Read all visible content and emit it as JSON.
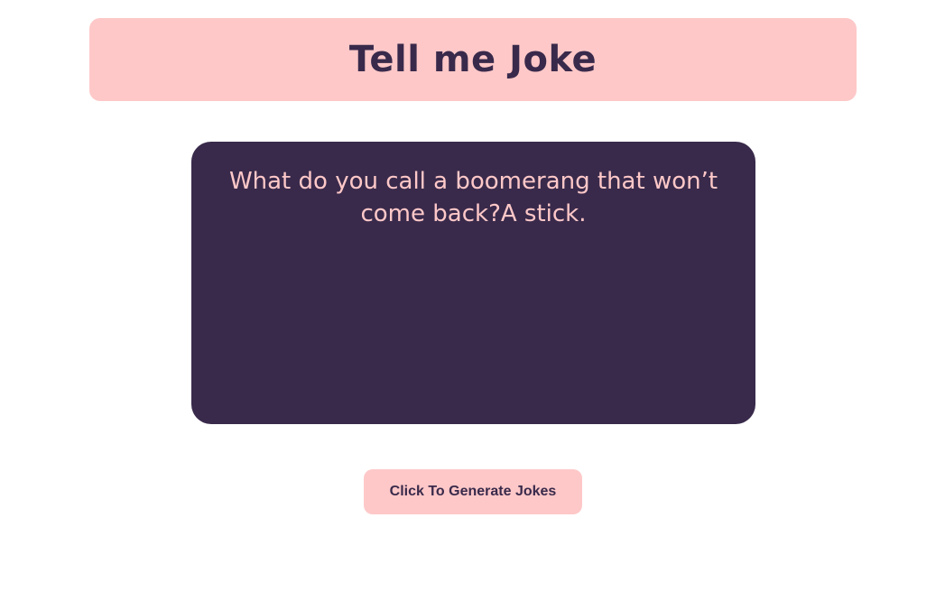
{
  "header": {
    "title": "Tell me Joke"
  },
  "joke": {
    "text": "What do you call a boomerang that won’t come back?A stick."
  },
  "actions": {
    "generate_label": "Click To Generate Jokes"
  },
  "colors": {
    "accent_pink": "#fec8c8",
    "dark_purple": "#392a4b",
    "background": "#ffffff"
  }
}
